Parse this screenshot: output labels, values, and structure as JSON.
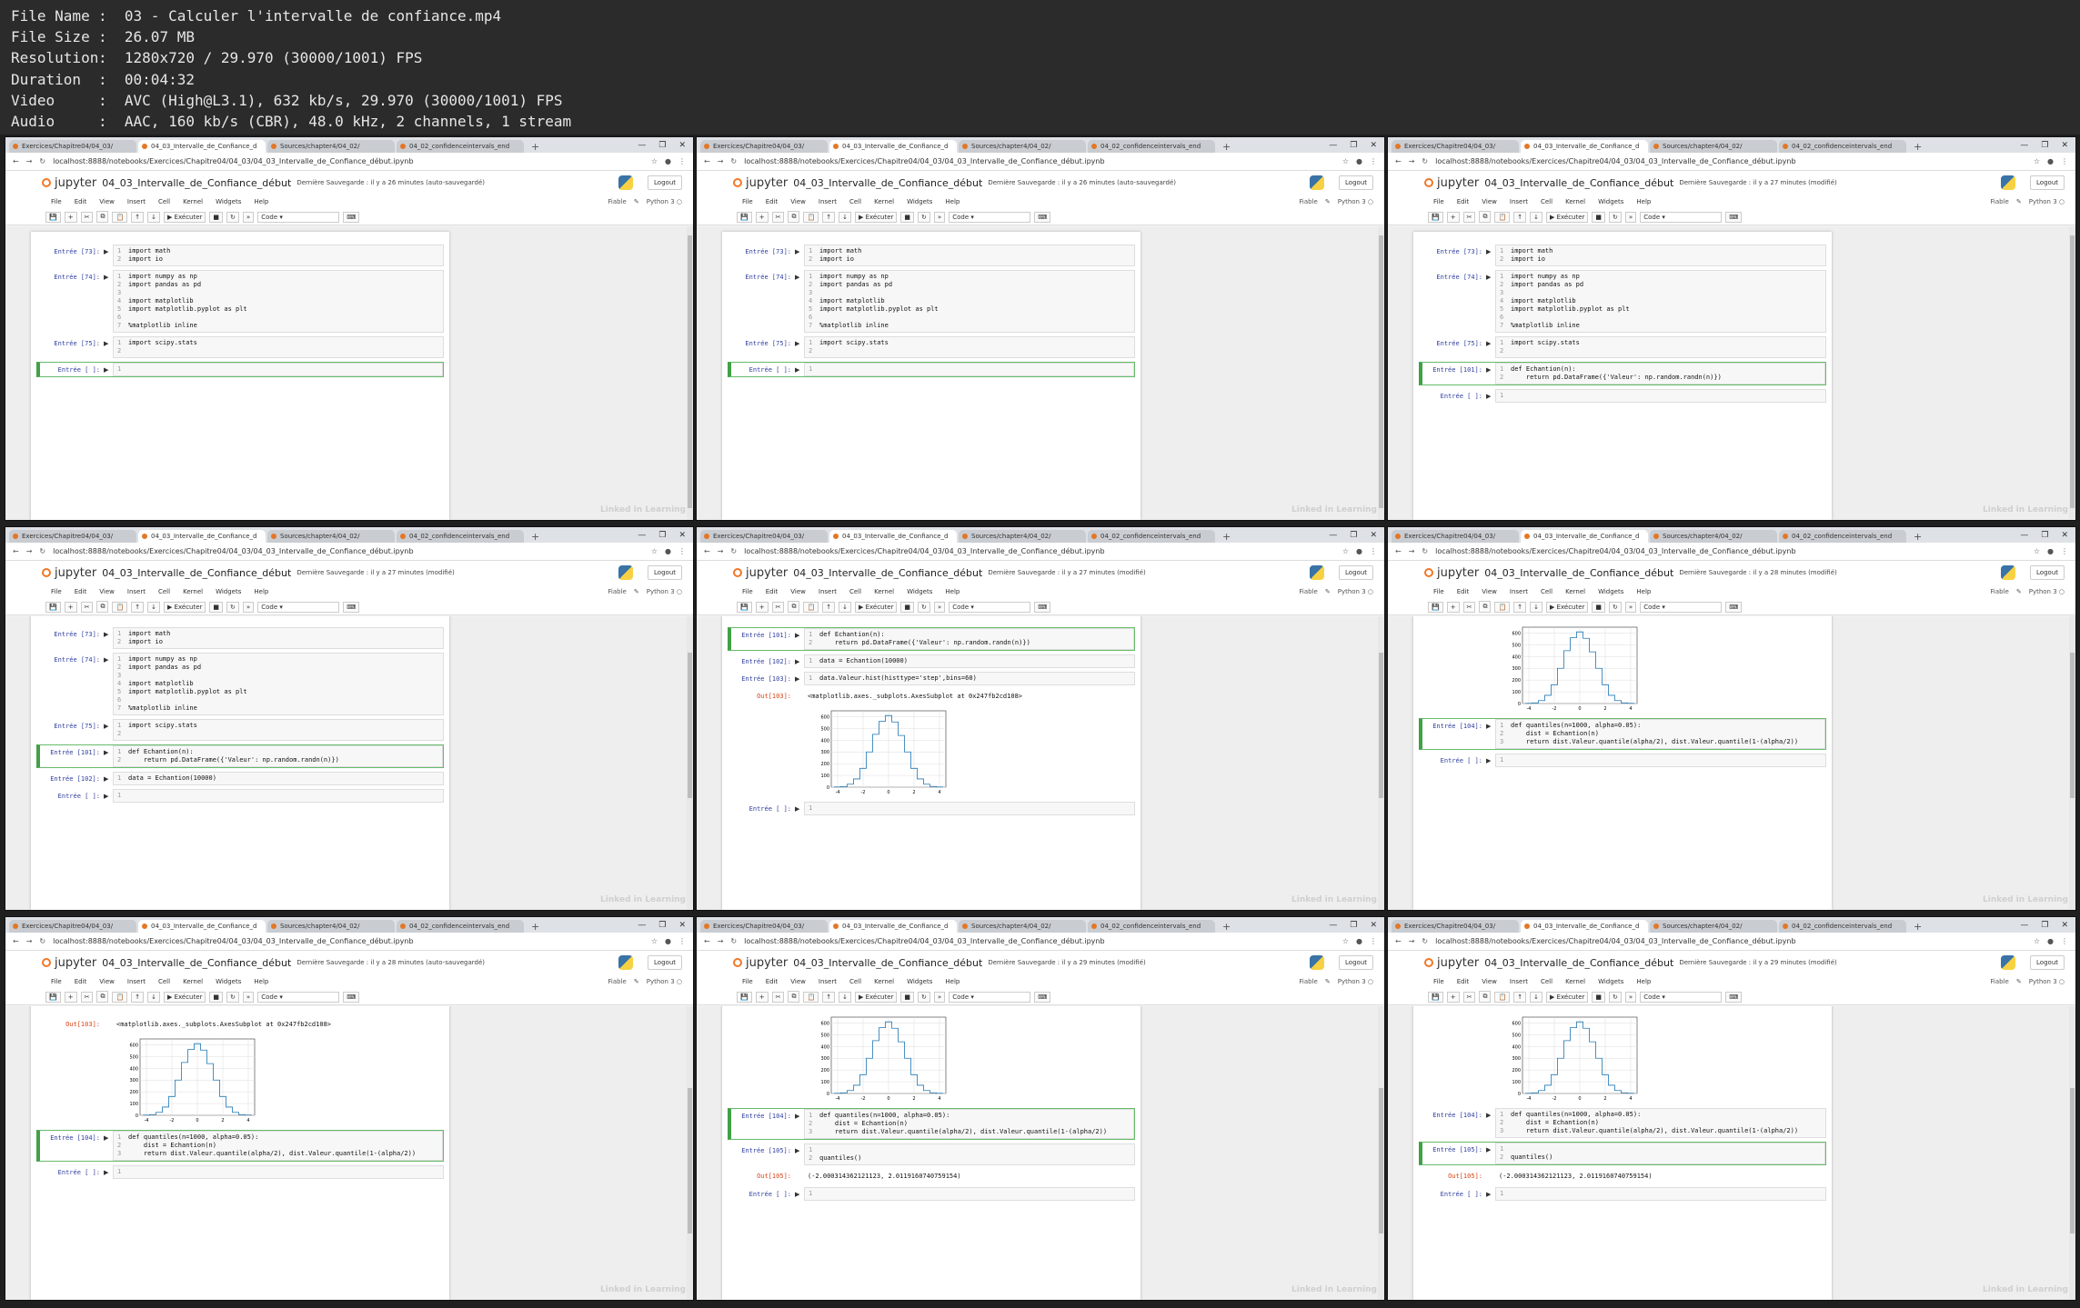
{
  "info": [
    {
      "k": "File Name",
      "v": "03 - Calculer l'intervalle de confiance.mp4"
    },
    {
      "k": "File Size",
      "v": "26.07 MB"
    },
    {
      "k": "Resolution",
      "v": "1280x720 / 29.970 (30000/1001) FPS"
    },
    {
      "k": "Duration",
      "v": "00:04:32"
    },
    {
      "k": "Video",
      "v": "AVC (High@L3.1), 632 kb/s, 29.970 (30000/1001) FPS"
    },
    {
      "k": "Audio",
      "v": "AAC, 160 kb/s (CBR), 48.0 kHz, 2 channels, 1 stream"
    }
  ],
  "browser": {
    "tabs": [
      "Exercices/Chapitre04/04_03/",
      "04_03_Intervalle_de_Confiance_d",
      "Sources/chapter4/04_02/",
      "04_02_confidenceintervals_end"
    ],
    "url": "localhost:8888/notebooks/Exercices/Chapitre04/04_03/04_03_Intervalle_de_Confiance_début.ipynb",
    "new_tab": "+"
  },
  "jupyter": {
    "logo": "jupyter",
    "notebook": "04_03_Intervalle_de_Confiance_début",
    "saved_prefix": "Dernière Sauvegarde : il y a",
    "logout": "Logout",
    "menu": [
      "File",
      "Edit",
      "View",
      "Insert",
      "Cell",
      "Kernel",
      "Widgets",
      "Help"
    ],
    "trusted": "Fiable",
    "kernel": "Python 3",
    "run": "Exécuter",
    "celltype": "Code"
  },
  "code": {
    "c73": [
      "import math",
      "import io"
    ],
    "c74": [
      "import numpy as np",
      "import pandas as pd",
      "",
      "import matplotlib",
      "import matplotlib.pyplot as plt",
      "",
      "%matplotlib inline"
    ],
    "c75": [
      "import scipy.stats",
      ""
    ],
    "c101": [
      "def Echantion(n):",
      "    return pd.DataFrame({'Valeur': np.random.randn(n)})"
    ],
    "c102": [
      "data = Echantion(10000)"
    ],
    "c103": [
      "data.Valeur.hist(histtype='step',bins=60)"
    ],
    "out103": "<matplotlib.axes._subplots.AxesSubplot at 0x247fb2cd108>",
    "c104a": [
      "def quantiles(n=1000, alpha=0.05):",
      "    dist = Echantion(n)",
      "    return dist.Valeur.quantile(alpha/2), dist.Valeur.quantile(1-(alpha/2))"
    ],
    "c105": [
      "",
      "quantiles()"
    ],
    "out105": "(-2.000314362121123, 2.0119160740759154)"
  },
  "prompts": {
    "p73": "Entrée [73]:",
    "p74": "Entrée [74]:",
    "p75": "Entrée [75]:",
    "p101": "Entrée [101]:",
    "p102": "Entrée [102]:",
    "p103": "Entrée [103]:",
    "p104": "Entrée [104]:",
    "p105": "Entrée [105]:",
    "pempty": "Entrée [ ]:",
    "o103": "Out[103]:",
    "o105": "Out[105]:"
  },
  "panels": [
    {
      "saved": "26 minutes",
      "status": "(auto-sauvegardé)"
    },
    {
      "saved": "26 minutes",
      "status": "(auto-sauvegardé)"
    },
    {
      "saved": "27 minutes",
      "status": "(modifié)"
    },
    {
      "saved": "27 minutes",
      "status": "(modifié)"
    },
    {
      "saved": "27 minutes",
      "status": "(modifié)"
    },
    {
      "saved": "28 minutes",
      "status": "(modifié)"
    },
    {
      "saved": "28 minutes",
      "status": "(auto-sauvegardé)"
    },
    {
      "saved": "29 minutes",
      "status": "(modifié)"
    },
    {
      "saved": "29 minutes",
      "status": "(modifié)"
    }
  ],
  "watermark": "Linked in Learning",
  "chart_data": {
    "type": "line",
    "x": [
      -4,
      -3.5,
      -3,
      -2.5,
      -2,
      -1.5,
      -1,
      -0.5,
      0,
      0.5,
      1,
      1.5,
      2,
      2.5,
      3,
      3.5,
      4
    ],
    "values": [
      2,
      6,
      25,
      70,
      160,
      300,
      450,
      560,
      610,
      555,
      440,
      300,
      160,
      70,
      25,
      6,
      2
    ],
    "xticks": [
      "-4",
      "-2",
      "0",
      "2",
      "4"
    ],
    "yticks": [
      "0",
      "100",
      "200",
      "300",
      "400",
      "500",
      "600"
    ],
    "ylim": [
      0,
      650
    ],
    "xlim": [
      -4.5,
      4.5
    ],
    "grid": true,
    "color": "#1f77b4"
  }
}
